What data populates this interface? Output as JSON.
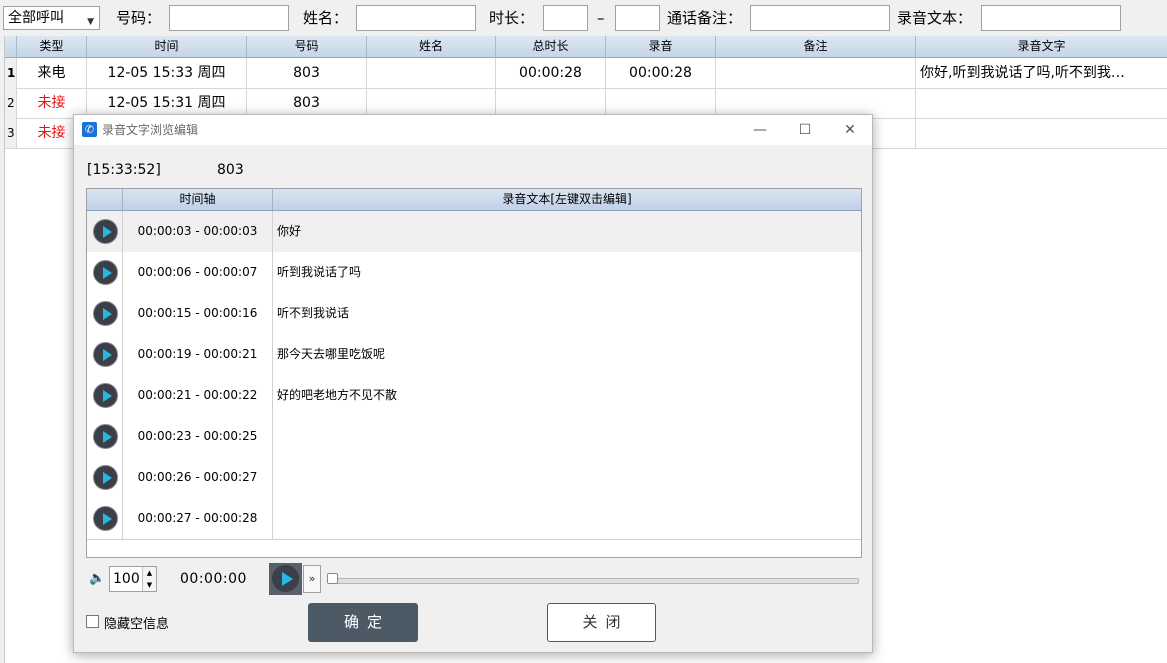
{
  "filters": {
    "call_type_selected": "全部呼叫",
    "number_label": "号码：",
    "name_label": "姓名：",
    "duration_label": "时长：",
    "range_sep": "–",
    "note_label": "通话备注：",
    "text_label": "录音文本："
  },
  "grid": {
    "columns": [
      "类型",
      "时间",
      "号码",
      "姓名",
      "总时长",
      "录音",
      "备注",
      "录音文字"
    ],
    "rows": [
      {
        "num": "1",
        "type": "来电",
        "time": "12-05 15:33 周四",
        "number": "803",
        "name": "",
        "duration": "00:00:28",
        "recording": "00:00:28",
        "note": "",
        "text": "你好,听到我说话了吗,听不到我…"
      },
      {
        "num": "2",
        "type": "未接",
        "time": "12-05 15:31 周四",
        "number": "803",
        "name": "",
        "duration": "",
        "recording": "",
        "note": "",
        "text": ""
      },
      {
        "num": "3",
        "type": "未接",
        "time": "",
        "number": "",
        "name": "",
        "duration": "",
        "recording": "",
        "note": "",
        "text": ""
      }
    ]
  },
  "dialog": {
    "title": "录音文字浏览编辑",
    "time": "[15:33:52]",
    "number": "803",
    "table_headers": {
      "timeline": "时间轴",
      "text": "录音文本[左键双击编辑]"
    },
    "segments": [
      {
        "range": "00:00:03 - 00:00:03",
        "text": "你好"
      },
      {
        "range": "00:00:06 - 00:00:07",
        "text": "听到我说话了吗"
      },
      {
        "range": "00:00:15 - 00:00:16",
        "text": "听不到我说话"
      },
      {
        "range": "00:00:19 - 00:00:21",
        "text": "那今天去哪里吃饭呢"
      },
      {
        "range": "00:00:21 - 00:00:22",
        "text": "好的吧老地方不见不散"
      },
      {
        "range": "00:00:23 - 00:00:25",
        "text": ""
      },
      {
        "range": "00:00:26 - 00:00:27",
        "text": ""
      },
      {
        "range": "00:00:27 - 00:00:28",
        "text": ""
      }
    ],
    "volume": "100",
    "position": "00:00:00",
    "playback_progress": 0,
    "hide_empty_label": "隐藏空信息",
    "ok_label": "确定",
    "close_label": "关闭"
  },
  "colors": {
    "missed": "#e31414",
    "play_accent": "#27b8e0",
    "ok_button": "#4c5a66"
  }
}
